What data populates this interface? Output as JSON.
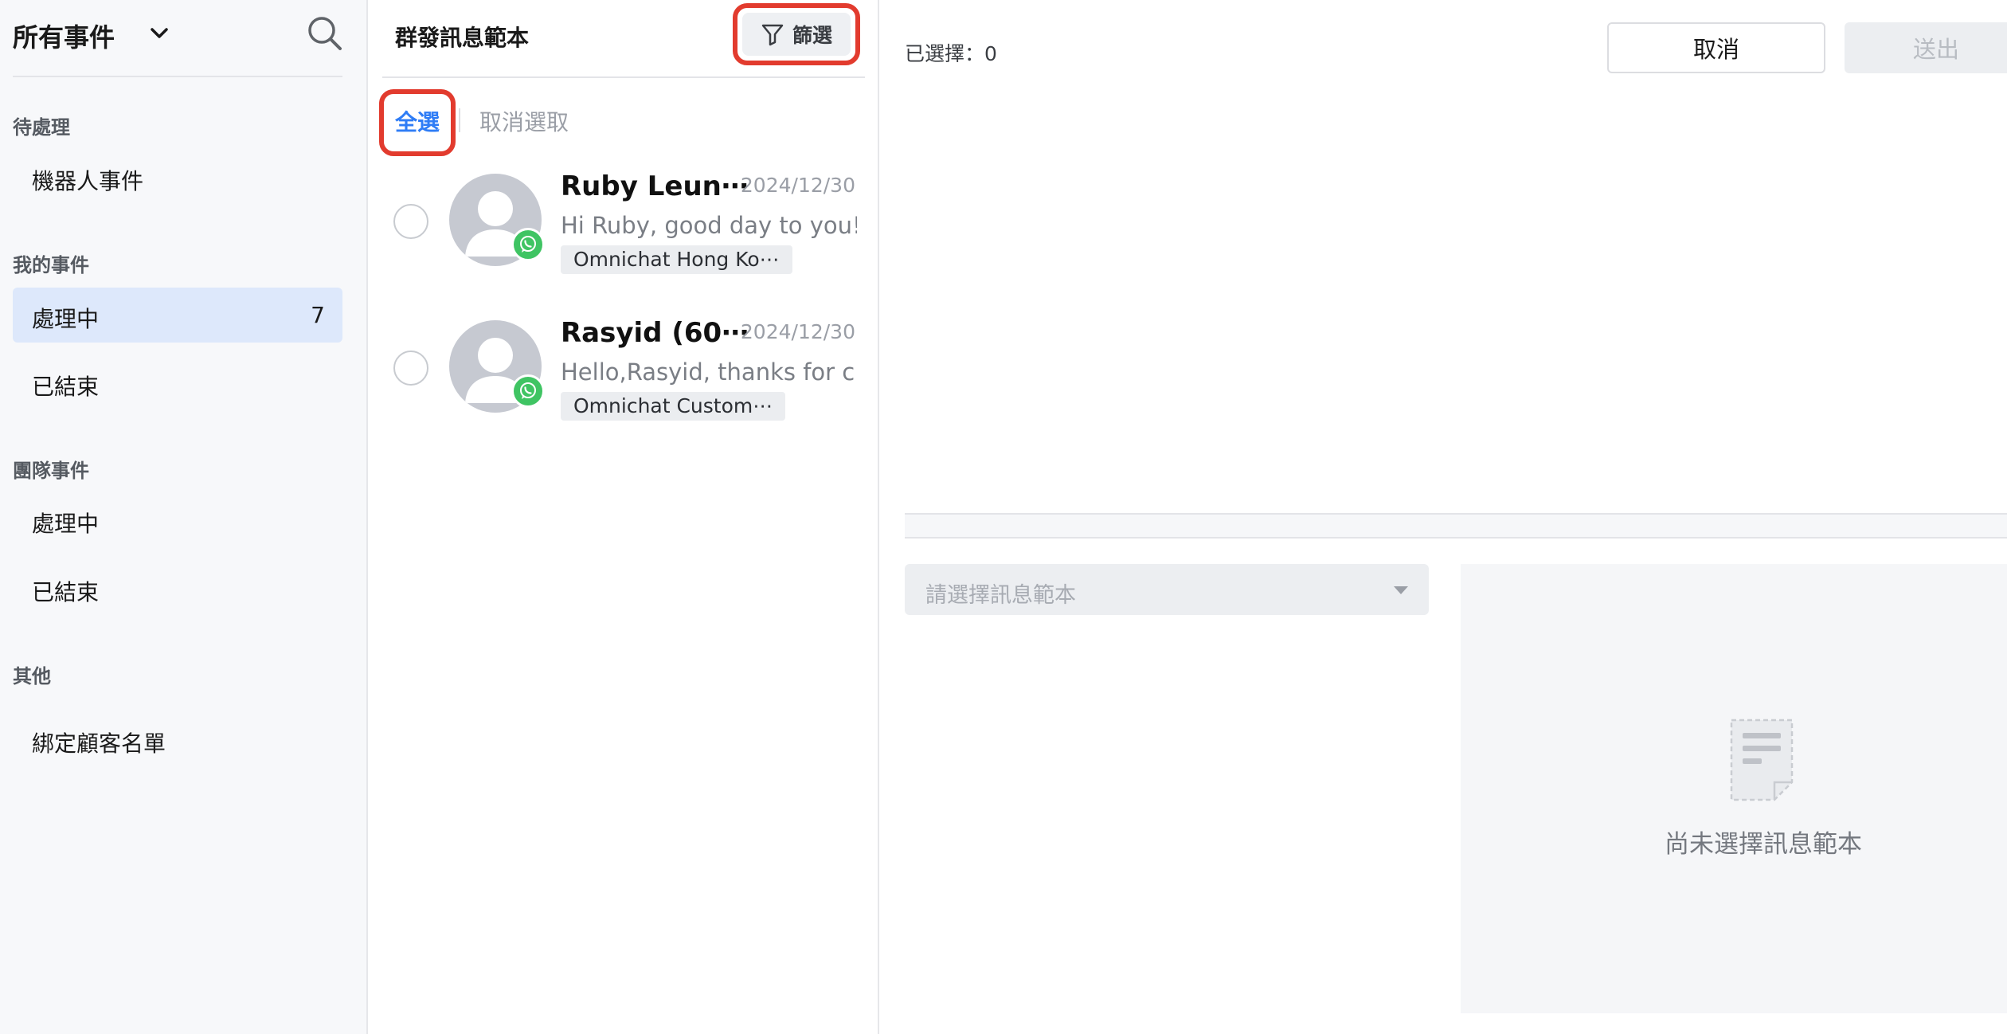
{
  "sidebar": {
    "title": "所有事件",
    "sections": {
      "pending": "待處理",
      "my_events": "我的事件",
      "team_events": "團隊事件",
      "other": "其他"
    },
    "items": {
      "bot_events": "機器人事件",
      "my_processing": "處理中",
      "my_processing_count": "7",
      "my_closed": "已結束",
      "team_processing": "處理中",
      "team_closed": "已結束",
      "bind_customers": "綁定顧客名單"
    }
  },
  "list": {
    "title": "群發訊息範本",
    "filter_label": "篩選",
    "select_all": "全選",
    "deselect": "取消選取",
    "conversations": [
      {
        "name": "Ruby Leun⋯",
        "date": "2024/12/30",
        "preview": "Hi Ruby, good day to you! ⋯",
        "tag": "Omnichat Hong Ko⋯",
        "channel": "whatsapp"
      },
      {
        "name": "Rasyid (60⋯",
        "date": "2024/12/30",
        "preview": "Hello,Rasyid, thanks for c⋯",
        "tag": "Omnichat Custom⋯",
        "channel": "whatsapp"
      }
    ]
  },
  "right": {
    "selected_count": "已選擇：0",
    "cancel_label": "取消",
    "send_label": "送出",
    "template_placeholder": "請選擇訊息範本",
    "empty_state": "尚未選擇訊息範本"
  },
  "colors": {
    "accent_blue": "#2f7df6",
    "active_bg": "#dde8fb",
    "highlight_red": "#e23b2e",
    "whatsapp_green": "#3fc463"
  },
  "icons": {
    "search": "search-icon",
    "chevron": "chevron-down-icon",
    "filter": "filter-icon",
    "whatsapp": "whatsapp-icon",
    "document": "document-icon"
  }
}
